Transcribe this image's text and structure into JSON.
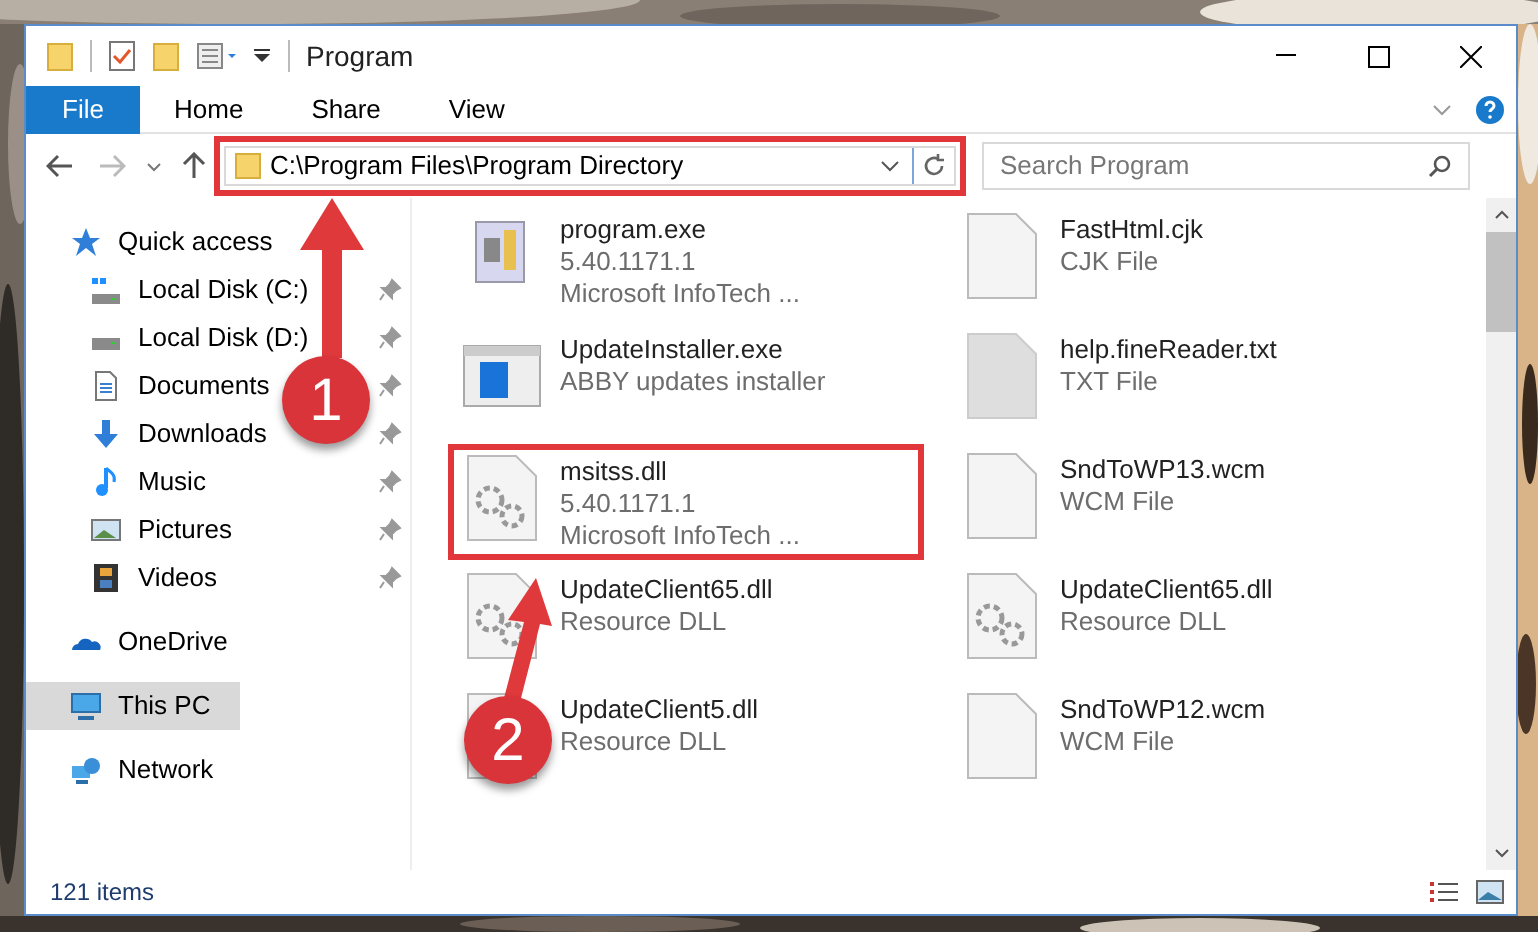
{
  "window": {
    "title": "Program"
  },
  "ribbon_tabs": [
    {
      "label": "File",
      "selected": true
    },
    {
      "label": "Home",
      "selected": false
    },
    {
      "label": "Share",
      "selected": false
    },
    {
      "label": "View",
      "selected": false
    }
  ],
  "address": {
    "path": "C:\\Program Files\\Program Directory"
  },
  "search": {
    "placeholder": "Search Program"
  },
  "sidebar": {
    "items": [
      {
        "label": "Quick access",
        "kind": "star",
        "selected": false,
        "children": [
          {
            "label": "Local Disk (C:)",
            "kind": "disk-c",
            "pinned": true,
            "selected": false
          },
          {
            "label": "Local Disk (D:)",
            "kind": "disk",
            "pinned": true,
            "selected": false
          },
          {
            "label": "Documents",
            "kind": "documents",
            "pinned": true,
            "selected": false
          },
          {
            "label": "Downloads",
            "kind": "downloads",
            "pinned": true,
            "selected": false
          },
          {
            "label": "Music",
            "kind": "music",
            "pinned": true,
            "selected": false
          },
          {
            "label": "Pictures",
            "kind": "pictures",
            "pinned": true,
            "selected": false
          },
          {
            "label": "Videos",
            "kind": "videos",
            "pinned": true,
            "selected": false
          }
        ]
      },
      {
        "label": "OneDrive",
        "kind": "cloud",
        "selected": false
      },
      {
        "label": "This PC",
        "kind": "pc",
        "selected": true
      },
      {
        "label": "Network",
        "kind": "network",
        "selected": false
      }
    ]
  },
  "files": [
    {
      "name": "program.exe",
      "details": [
        "5.40.1171.1",
        "Microsoft InfoTech ..."
      ],
      "kind": "program"
    },
    {
      "name": "FastHtml.cjk",
      "details": [
        "CJK File"
      ],
      "kind": "blank"
    },
    {
      "name": "UpdateInstaller.exe",
      "details": [
        "ABBY updates installer"
      ],
      "kind": "installer"
    },
    {
      "name": "help.fineReader.txt",
      "details": [
        "TXT File"
      ],
      "kind": "gray"
    },
    {
      "name": "msitss.dll",
      "details": [
        "5.40.1171.1",
        "Microsoft InfoTech ..."
      ],
      "kind": "dll"
    },
    {
      "name": "SndToWP13.wcm",
      "details": [
        "WCM File"
      ],
      "kind": "blank"
    },
    {
      "name": "UpdateClient65.dll",
      "details": [
        "Resource DLL"
      ],
      "kind": "dll"
    },
    {
      "name": "UpdateClient65.dll",
      "details": [
        "Resource DLL"
      ],
      "kind": "dll"
    },
    {
      "name": "UpdateClient5.dll",
      "details": [
        "Resource DLL"
      ],
      "kind": "dll"
    },
    {
      "name": "SndToWP12.wcm",
      "details": [
        "WCM File"
      ],
      "kind": "blank"
    }
  ],
  "status_bar": {
    "item_count": "121 items"
  },
  "callouts": [
    {
      "number": "1"
    },
    {
      "number": "2"
    }
  ]
}
